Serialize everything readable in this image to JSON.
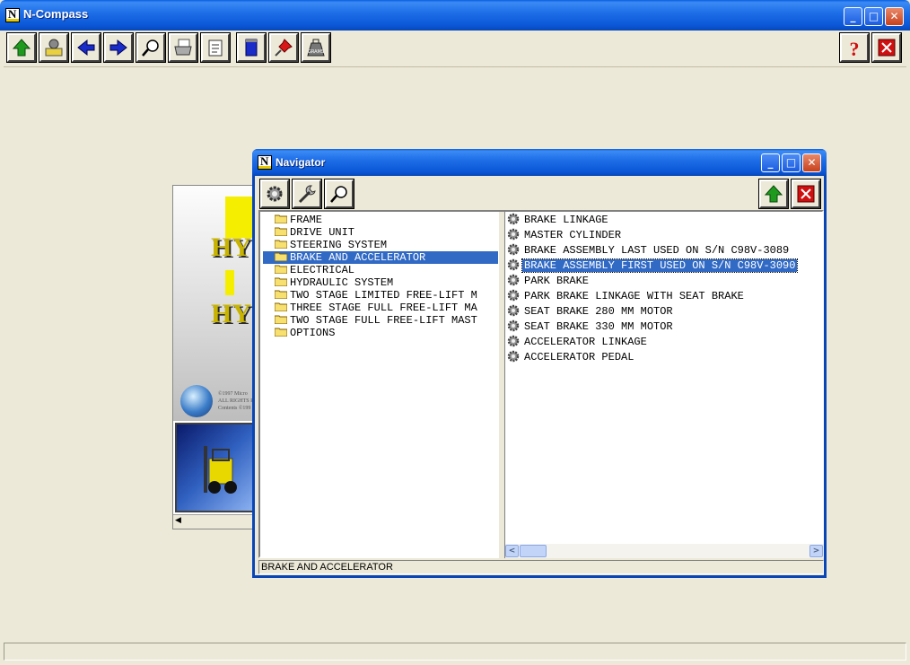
{
  "app": {
    "title": "N-Compass",
    "window_controls": [
      "minimize",
      "maximize",
      "close"
    ]
  },
  "toolbar": {
    "buttons": [
      {
        "icon": "up-arrow-icon",
        "label": "Up"
      },
      {
        "icon": "open-catalog-icon",
        "label": "Open"
      },
      {
        "icon": "back-arrow-icon",
        "label": "Back"
      },
      {
        "icon": "forward-arrow-icon",
        "label": "Forward"
      },
      {
        "icon": "search-magnifier-icon",
        "label": "Search"
      },
      {
        "icon": "printer-icon",
        "label": "Print"
      },
      {
        "icon": "notes-icon",
        "label": "Notes"
      },
      {
        "icon": "notepad-icon",
        "label": "Notepad"
      },
      {
        "icon": "pushpin-icon",
        "label": "Bookmark"
      },
      {
        "icon": "grams-weight-icon",
        "label": "GRAMS"
      },
      {
        "icon": "help-icon",
        "label": "Help"
      },
      {
        "icon": "exit-icon",
        "label": "Exit"
      }
    ],
    "grams_text": "GRAMS",
    "help_glyph": "?"
  },
  "splash": {
    "brand_fragment_1": "HY",
    "brand_fragment_2": "HY",
    "copyright_lines": [
      "©1997 Micro",
      "ALL RIGHTS R",
      "Contents ©199"
    ]
  },
  "navigator": {
    "title": "Navigator",
    "tools": [
      {
        "icon": "gear-icon"
      },
      {
        "icon": "wrench-icon"
      },
      {
        "icon": "search-magnifier-icon"
      }
    ],
    "tree": [
      {
        "label": "FRAME",
        "selected": false
      },
      {
        "label": "DRIVE UNIT",
        "selected": false
      },
      {
        "label": "STEERING SYSTEM",
        "selected": false
      },
      {
        "label": "BRAKE AND ACCELERATOR",
        "selected": true
      },
      {
        "label": "ELECTRICAL",
        "selected": false
      },
      {
        "label": "HYDRAULIC SYSTEM",
        "selected": false
      },
      {
        "label": "TWO STAGE LIMITED FREE-LIFT M",
        "selected": false
      },
      {
        "label": "THREE STAGE FULL FREE-LIFT MA",
        "selected": false
      },
      {
        "label": "TWO STAGE FULL FREE-LIFT MAST",
        "selected": false
      },
      {
        "label": "OPTIONS",
        "selected": false
      }
    ],
    "list": [
      {
        "label": "BRAKE LINKAGE",
        "selected": false
      },
      {
        "label": "MASTER CYLINDER",
        "selected": false
      },
      {
        "label": "BRAKE ASSEMBLY LAST USED ON S/N C98V-3089",
        "selected": false
      },
      {
        "label": "BRAKE ASSEMBLY FIRST USED ON S/N C98V-3090",
        "selected": true
      },
      {
        "label": "PARK BRAKE",
        "selected": false
      },
      {
        "label": "PARK BRAKE LINKAGE WITH SEAT BRAKE",
        "selected": false
      },
      {
        "label": "SEAT BRAKE 280 MM MOTOR",
        "selected": false
      },
      {
        "label": "SEAT BRAKE 330 MM MOTOR",
        "selected": false
      },
      {
        "label": "ACCELERATOR LINKAGE",
        "selected": false
      },
      {
        "label": "ACCELERATOR PEDAL",
        "selected": false
      }
    ],
    "status": "BRAKE AND ACCELERATOR"
  },
  "colors": {
    "title_bar": "#0a56d6",
    "selection": "#316ac5",
    "window_bg": "#ece9d8"
  }
}
